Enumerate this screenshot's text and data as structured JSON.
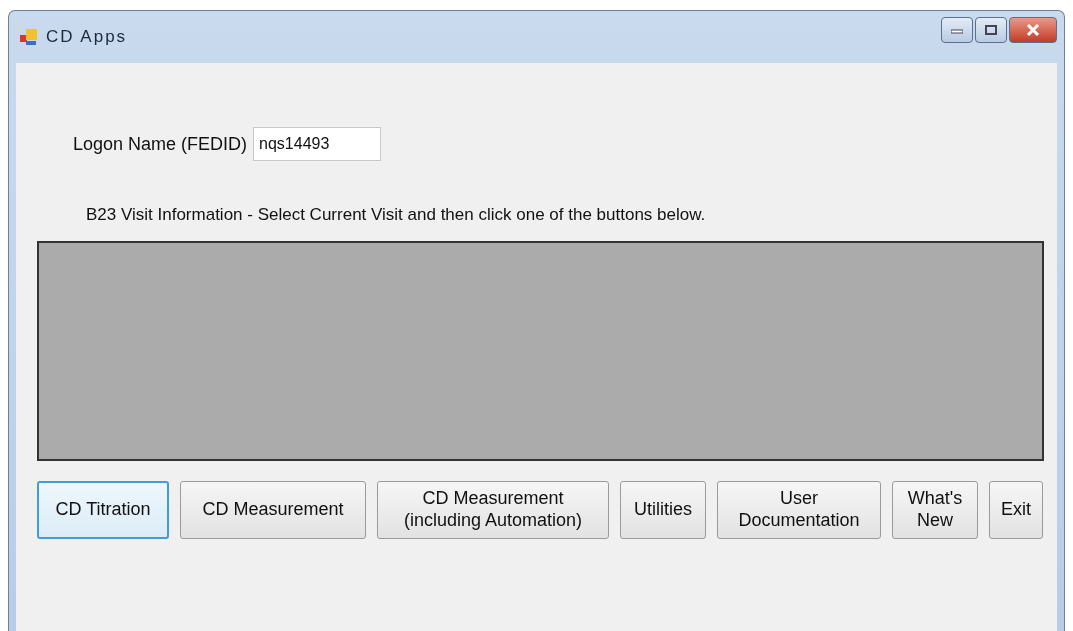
{
  "window": {
    "title": "CD Apps"
  },
  "logon": {
    "label": "Logon Name (FEDID)",
    "value": "nqs14493"
  },
  "visit_info": {
    "label": "B23 Visit Information - Select Current Visit and then click one of the buttons below."
  },
  "buttons": [
    {
      "label": "CD Titration",
      "focused": true
    },
    {
      "label": "CD Measurement",
      "focused": false
    },
    {
      "label": "CD Measurement\n(including Automation)",
      "focused": false
    },
    {
      "label": "Utilities",
      "focused": false
    },
    {
      "label": "User\nDocumentation",
      "focused": false
    },
    {
      "label": "What's\nNew",
      "focused": false
    },
    {
      "label": "Exit",
      "focused": false
    }
  ]
}
